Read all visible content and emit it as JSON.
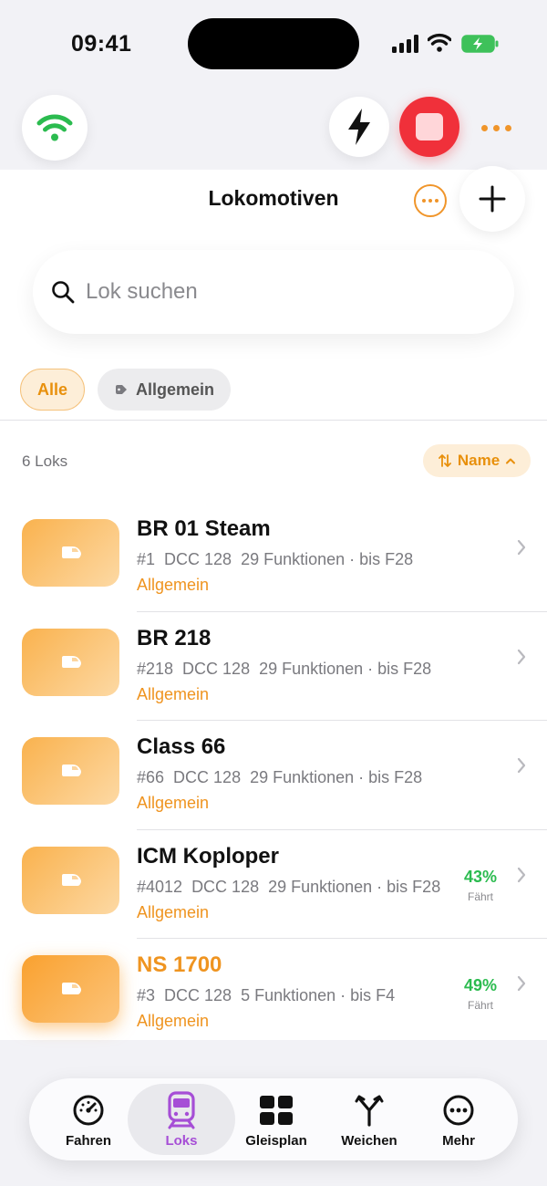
{
  "status_bar": {
    "time": "09:41"
  },
  "header": {
    "title": "Lokomotiven"
  },
  "search": {
    "placeholder": "Lok suchen"
  },
  "filters": [
    {
      "label": "Alle",
      "active": true
    },
    {
      "label": "Allgemein",
      "active": false
    }
  ],
  "list_summary": {
    "count": "6 Loks",
    "sort_label": "Name"
  },
  "locomotives": [
    {
      "name": "BR 01 Steam",
      "address": "#1",
      "protocol": "DCC 128",
      "functions": "29 Funktionen · bis F28",
      "category": "Allgemein",
      "speed": null,
      "speed_label": null,
      "active": false
    },
    {
      "name": "BR 218",
      "address": "#218",
      "protocol": "DCC 128",
      "functions": "29 Funktionen · bis F28",
      "category": "Allgemein",
      "speed": null,
      "speed_label": null,
      "active": false
    },
    {
      "name": "Class 66",
      "address": "#66",
      "protocol": "DCC 128",
      "functions": "29 Funktionen · bis F28",
      "category": "Allgemein",
      "speed": null,
      "speed_label": null,
      "active": false
    },
    {
      "name": "ICM Koploper",
      "address": "#4012",
      "protocol": "DCC 128",
      "functions": "29 Funktionen · bis F28",
      "category": "Allgemein",
      "speed": "43%",
      "speed_label": "Fährt",
      "active": false
    },
    {
      "name": "NS 1700",
      "address": "#3",
      "protocol": "DCC 128",
      "functions": "5 Funktionen · bis F4",
      "category": "Allgemein",
      "speed": "49%",
      "speed_label": "Fährt",
      "active": true
    }
  ],
  "tab_bar": [
    {
      "label": "Fahren",
      "icon": "speedometer-icon",
      "active": false
    },
    {
      "label": "Loks",
      "icon": "train-icon",
      "active": true
    },
    {
      "label": "Gleisplan",
      "icon": "grid-icon",
      "active": false
    },
    {
      "label": "Weichen",
      "icon": "switch-fork-icon",
      "active": false
    },
    {
      "label": "Mehr",
      "icon": "more-circle-icon",
      "active": false
    }
  ],
  "colors": {
    "accent": "#F0952A",
    "stop": "#F0303A",
    "go": "#2BBB4F",
    "tab_active": "#A64ED6",
    "connected": "#2BBB4F"
  }
}
